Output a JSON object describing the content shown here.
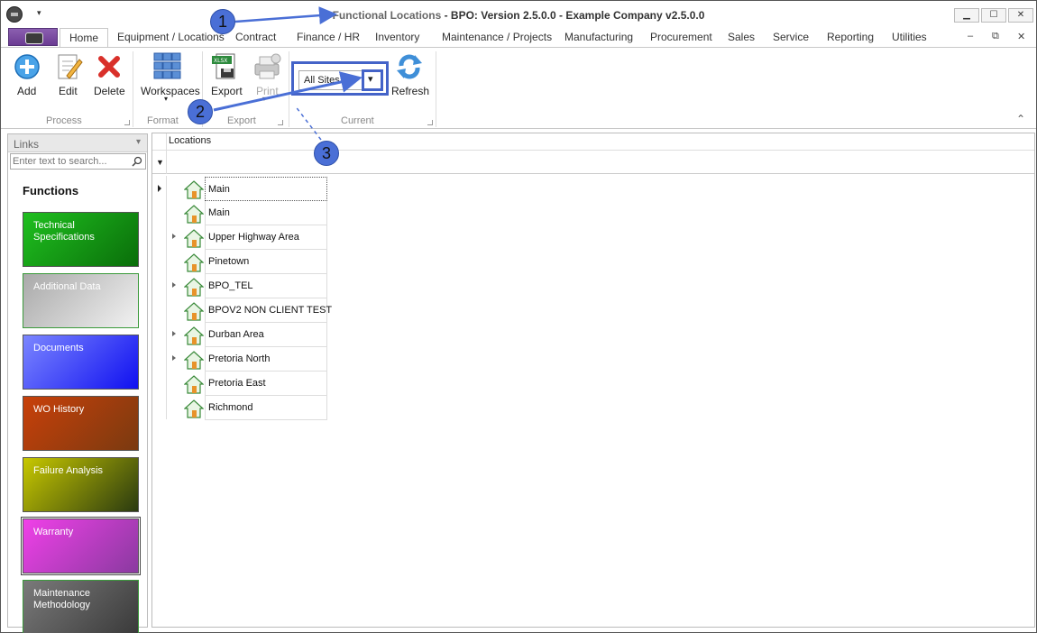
{
  "window": {
    "title_prefix": "Functional Locations",
    "title_rest": " - BPO: Version 2.5.0.0 - Example Company v2.5.0.0",
    "qa_dropdown": "▾",
    "controls": {
      "minimize": "▁",
      "maximize": "☐",
      "close": "✕"
    },
    "mdi_controls": {
      "minimize": "–",
      "restore": "⧉",
      "close": "✕"
    }
  },
  "tabs": [
    {
      "label": "Home",
      "active": true
    },
    {
      "label": "Equipment / Locations"
    },
    {
      "label": "Contract"
    },
    {
      "label": "Finance / HR"
    },
    {
      "label": "Inventory"
    },
    {
      "label": "Maintenance / Projects"
    },
    {
      "label": "Manufacturing"
    },
    {
      "label": "Procurement"
    },
    {
      "label": "Sales"
    },
    {
      "label": "Service"
    },
    {
      "label": "Reporting"
    },
    {
      "label": "Utilities"
    }
  ],
  "ribbon": {
    "groups": {
      "process": "Process",
      "format": "Format",
      "export": "Export",
      "current": "Current"
    },
    "buttons": {
      "add": "Add",
      "edit": "Edit",
      "delete": "Delete",
      "workspaces": "Workspaces",
      "export": "Export",
      "print": "Print",
      "refresh": "Refresh"
    },
    "site_select": {
      "value": "All Sites",
      "dropdown_glyph": "▾"
    },
    "collapse_glyph": "⌃"
  },
  "links_panel": {
    "title": "Links",
    "pin_glyph": "📌",
    "search_placeholder": "Enter text to search...",
    "functions_title": "Functions",
    "functions": [
      {
        "label": "Technical Specifications",
        "colors": [
          "#1fbf1f",
          "#0a6e0a"
        ]
      },
      {
        "label": "Additional Data",
        "colors": [
          "#a9a9a9",
          "#f2f2f2"
        ]
      },
      {
        "label": "Documents",
        "colors": [
          "#7b86ff",
          "#1010f0"
        ]
      },
      {
        "label": "WO History",
        "colors": [
          "#c8400a",
          "#7a3a10"
        ]
      },
      {
        "label": "Failure Analysis",
        "colors": [
          "#c8c800",
          "#2a3a10"
        ]
      },
      {
        "label": "Warranty",
        "colors": [
          "#f040e8",
          "#8a3aa0"
        ]
      },
      {
        "label": "Maintenance Methodology",
        "colors": [
          "#7a7a7a",
          "#3a3a3a"
        ]
      }
    ]
  },
  "grid": {
    "column_header": "Locations",
    "filter_glyph": "▾",
    "rows": [
      {
        "label": "Main",
        "expandable": false,
        "focused": true
      },
      {
        "label": "Main",
        "expandable": false
      },
      {
        "label": "Upper Highway Area",
        "expandable": true
      },
      {
        "label": "Pinetown",
        "expandable": false
      },
      {
        "label": "BPO_TEL",
        "expandable": true
      },
      {
        "label": "BPOV2 NON CLIENT TEST",
        "expandable": false
      },
      {
        "label": "Durban Area",
        "expandable": true
      },
      {
        "label": "Pretoria North",
        "expandable": true
      },
      {
        "label": "Pretoria East",
        "expandable": false
      },
      {
        "label": "Richmond",
        "expandable": false
      }
    ]
  },
  "annotations": {
    "callout_1": "1",
    "callout_2": "2",
    "callout_3": "3",
    "color": "#4a6fd6"
  }
}
